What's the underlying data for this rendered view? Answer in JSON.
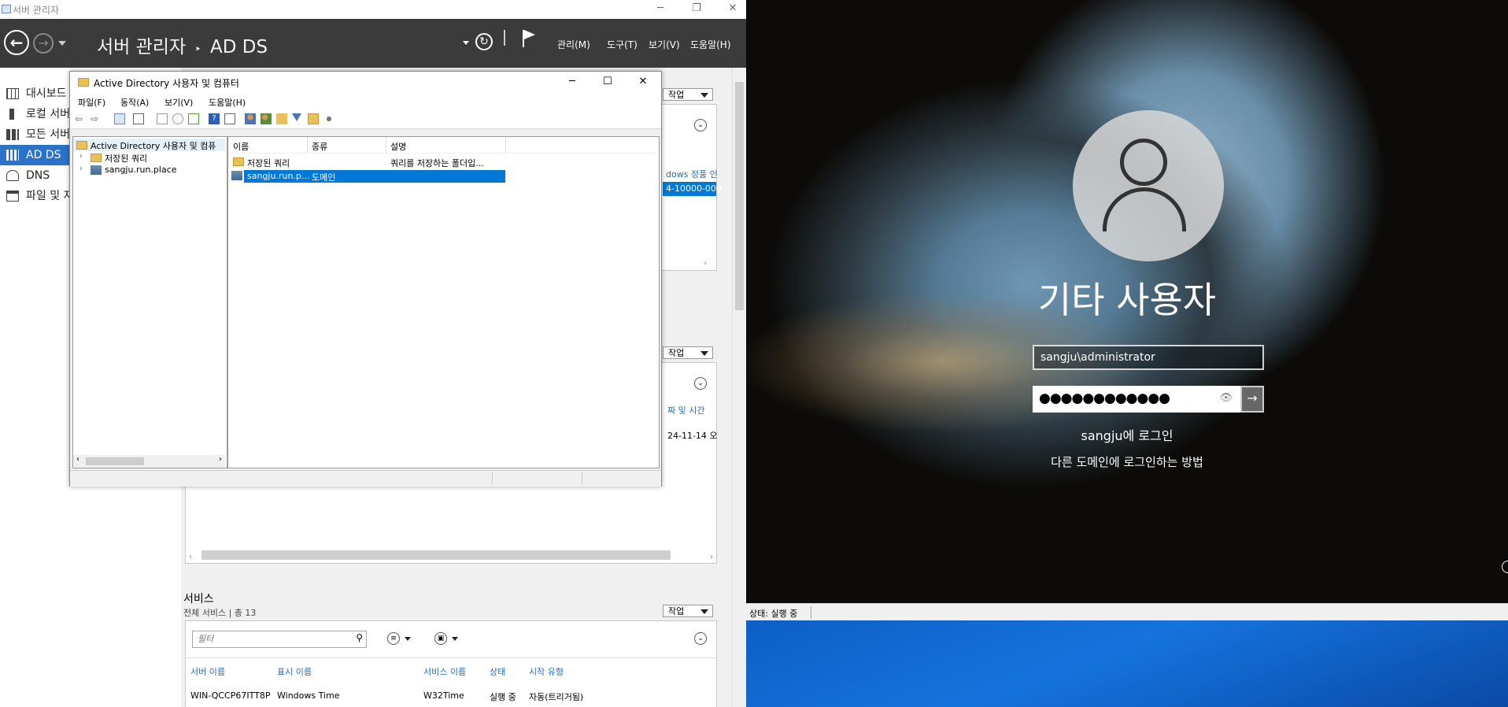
{
  "server_manager": {
    "window_title": "서버 관리자",
    "breadcrumb_root": "서버 관리자",
    "breadcrumb_sep": "‣",
    "breadcrumb_current": "AD DS",
    "menus": [
      "관리(M)",
      "도구(T)",
      "보기(V)",
      "도움말(H)"
    ],
    "nav": [
      "대시보드",
      "로컬 서버",
      "모든 서버",
      "AD DS",
      "DNS",
      "파일 및 저장소 서비스"
    ],
    "task_label": "작업",
    "partial_text": {
      "windows_activation": "dows 정품 인",
      "product_id": "4-10000-000",
      "date_time_col": "짜 및 시간",
      "date_value": "24-11-14 오"
    },
    "services": {
      "title": "서비스",
      "subtitle": "전체 서비스 | 총 13",
      "filter_placeholder": "필터",
      "columns": [
        "서버 이름",
        "표시 이름",
        "서비스 이름",
        "상태",
        "시작 유형"
      ],
      "rows": [
        [
          "WIN-QCCP67ITT8P",
          "Windows Time",
          "W32Time",
          "실행 중",
          "자동(트리거됨)"
        ]
      ]
    }
  },
  "ad_window": {
    "title": "Active Directory 사용자 및 컴퓨터",
    "menus": [
      "파일(F)",
      "동작(A)",
      "보기(V)",
      "도움말(H)"
    ],
    "tree": {
      "root": "Active Directory 사용자 및 컴퓨",
      "children": [
        "저장된 쿼리",
        "sangju.run.place"
      ]
    },
    "columns": [
      "이름",
      "종류",
      "설명"
    ],
    "rows": [
      {
        "name": "저장된 쿼리",
        "type": "",
        "desc": "쿼리를 저장하는 폴더입..."
      },
      {
        "name": "sangju.run.p...",
        "type": "도메인",
        "desc": ""
      }
    ]
  },
  "lock_screen": {
    "user_name": "기타 사용자",
    "username_value": "sangju\\administrator",
    "password_mask": "●●●●●●●●●●●●",
    "sign_in_to": "sangju에 로그인",
    "other_domain_link": "다른 도메인에 로그인하는 방법"
  },
  "vm_status": "상태: 실행 중",
  "colors": {
    "header_bg": "#3b3b3b",
    "nav_selected": "#2b73c9",
    "selection": "#0078d7",
    "desktop_blue": "#1573dd"
  }
}
